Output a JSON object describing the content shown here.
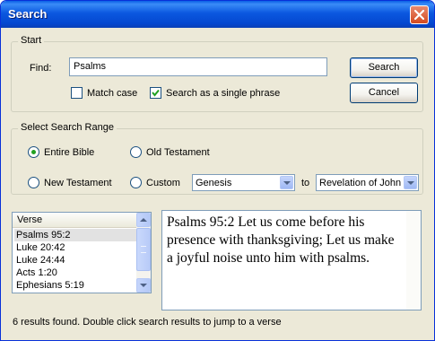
{
  "window": {
    "title": "Search"
  },
  "start_group": {
    "label": "Start",
    "find_label": "Find:",
    "find_value": "Psalms",
    "match_case": {
      "label": "Match case",
      "checked": false
    },
    "single_phrase": {
      "label": "Search as a single phrase",
      "checked": true
    },
    "search_button": "Search",
    "cancel_button": "Cancel"
  },
  "range_group": {
    "label": "Select Search Range",
    "options": {
      "entire_bible": "Entire Bible",
      "old_testament": "Old Testament",
      "new_testament": "New Testament",
      "custom": "Custom"
    },
    "selected": "entire_bible",
    "from_book": "Genesis",
    "to_label": "to",
    "to_book": "Revelation of John"
  },
  "results": {
    "column_header": "Verse",
    "items": [
      "Psalms 95:2",
      "Luke 20:42",
      "Luke 24:44",
      "Acts 1:20",
      "Ephesians 5:19"
    ],
    "selected_index": 0
  },
  "preview": {
    "text": "Psalms 95:2 Let us come before his presence with thanksgiving; Let us make a joyful noise unto him with psalms."
  },
  "status_text": "6 results found. Double click search results to jump to a verse"
}
